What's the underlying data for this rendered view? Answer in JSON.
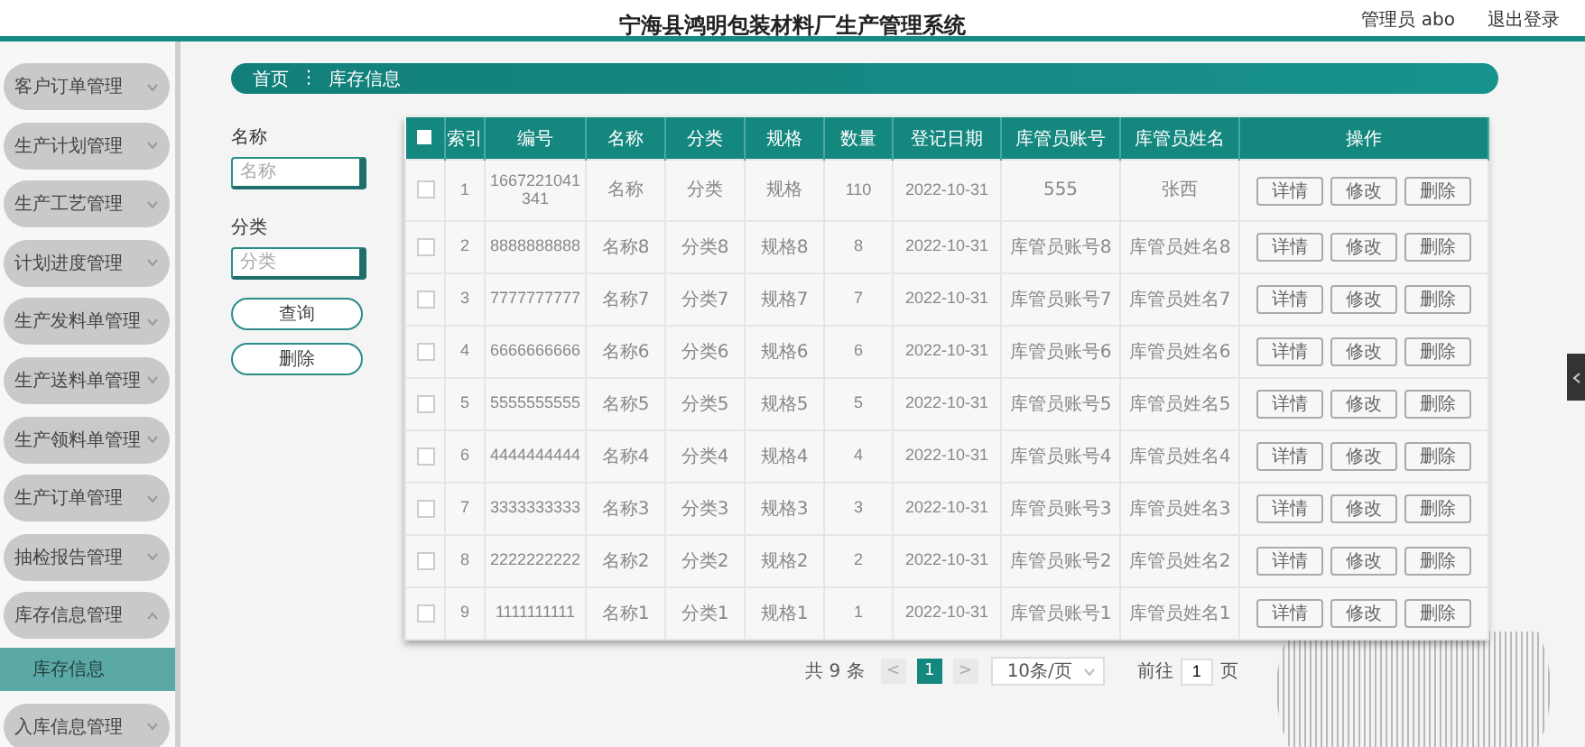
{
  "header": {
    "title": "宁海县鸿明包装材料厂生产管理系统",
    "user": "管理员 abo",
    "logout": "退出登录"
  },
  "sidebar": {
    "items": [
      {
        "label": "客户订单管理",
        "expanded": false
      },
      {
        "label": "生产计划管理",
        "expanded": false
      },
      {
        "label": "生产工艺管理",
        "expanded": false
      },
      {
        "label": "计划进度管理",
        "expanded": false
      },
      {
        "label": "生产发料单管理",
        "expanded": false
      },
      {
        "label": "生产送料单管理",
        "expanded": false
      },
      {
        "label": "生产领料单管理",
        "expanded": false
      },
      {
        "label": "生产订单管理",
        "expanded": false
      },
      {
        "label": "抽检报告管理",
        "expanded": false
      },
      {
        "label": "库存信息管理",
        "expanded": true,
        "children": [
          {
            "label": "库存信息",
            "selected": true
          }
        ]
      },
      {
        "label": "入库信息管理",
        "expanded": false
      }
    ]
  },
  "breadcrumb": {
    "home": "首页",
    "separator": "⋮",
    "current": "库存信息"
  },
  "search": {
    "fields": [
      {
        "label": "名称",
        "placeholder": "名称"
      },
      {
        "label": "分类",
        "placeholder": "分类"
      }
    ],
    "buttons": [
      "查询",
      "删除"
    ]
  },
  "table": {
    "select_all": {
      "checked": false
    },
    "columns": [
      "索引",
      "编号",
      "名称",
      "分类",
      "规格",
      "数量",
      "登记日期",
      "库管员账号",
      "库管员姓名",
      "操作"
    ],
    "rows": [
      {
        "checked": false,
        "cells": [
          "1",
          "1667221041341",
          "名称",
          "分类",
          "规格",
          "110",
          "2022-10-31",
          "555",
          "张西"
        ],
        "actions": [
          "详情",
          "修改",
          "删除"
        ]
      },
      {
        "checked": false,
        "cells": [
          "2",
          "8888888888",
          "名称8",
          "分类8",
          "规格8",
          "8",
          "2022-10-31",
          "库管员账号8",
          "库管员姓名8"
        ],
        "actions": [
          "详情",
          "修改",
          "删除"
        ]
      },
      {
        "checked": false,
        "cells": [
          "3",
          "7777777777",
          "名称7",
          "分类7",
          "规格7",
          "7",
          "2022-10-31",
          "库管员账号7",
          "库管员姓名7"
        ],
        "actions": [
          "详情",
          "修改",
          "删除"
        ]
      },
      {
        "checked": false,
        "cells": [
          "4",
          "6666666666",
          "名称6",
          "分类6",
          "规格6",
          "6",
          "2022-10-31",
          "库管员账号6",
          "库管员姓名6"
        ],
        "actions": [
          "详情",
          "修改",
          "删除"
        ]
      },
      {
        "checked": false,
        "cells": [
          "5",
          "5555555555",
          "名称5",
          "分类5",
          "规格5",
          "5",
          "2022-10-31",
          "库管员账号5",
          "库管员姓名5"
        ],
        "actions": [
          "详情",
          "修改",
          "删除"
        ]
      },
      {
        "checked": false,
        "cells": [
          "6",
          "4444444444",
          "名称4",
          "分类4",
          "规格4",
          "4",
          "2022-10-31",
          "库管员账号4",
          "库管员姓名4"
        ],
        "actions": [
          "详情",
          "修改",
          "删除"
        ]
      },
      {
        "checked": false,
        "cells": [
          "7",
          "3333333333",
          "名称3",
          "分类3",
          "规格3",
          "3",
          "2022-10-31",
          "库管员账号3",
          "库管员姓名3"
        ],
        "actions": [
          "详情",
          "修改",
          "删除"
        ]
      },
      {
        "checked": false,
        "cells": [
          "8",
          "2222222222",
          "名称2",
          "分类2",
          "规格2",
          "2",
          "2022-10-31",
          "库管员账号2",
          "库管员姓名2"
        ],
        "actions": [
          "详情",
          "修改",
          "删除"
        ]
      },
      {
        "checked": false,
        "cells": [
          "9",
          "1111111111",
          "名称1",
          "分类1",
          "规格1",
          "1",
          "2022-10-31",
          "库管员账号1",
          "库管员姓名1"
        ],
        "actions": [
          "详情",
          "修改",
          "删除"
        ]
      }
    ]
  },
  "pagination": {
    "total": "共 9 条",
    "prev": "<",
    "pages": [
      {
        "label": "1",
        "selected": true
      }
    ],
    "next": ">",
    "page_size": "10条/页",
    "goto_label": "前往",
    "goto_value": "1",
    "goto_unit": "页"
  }
}
